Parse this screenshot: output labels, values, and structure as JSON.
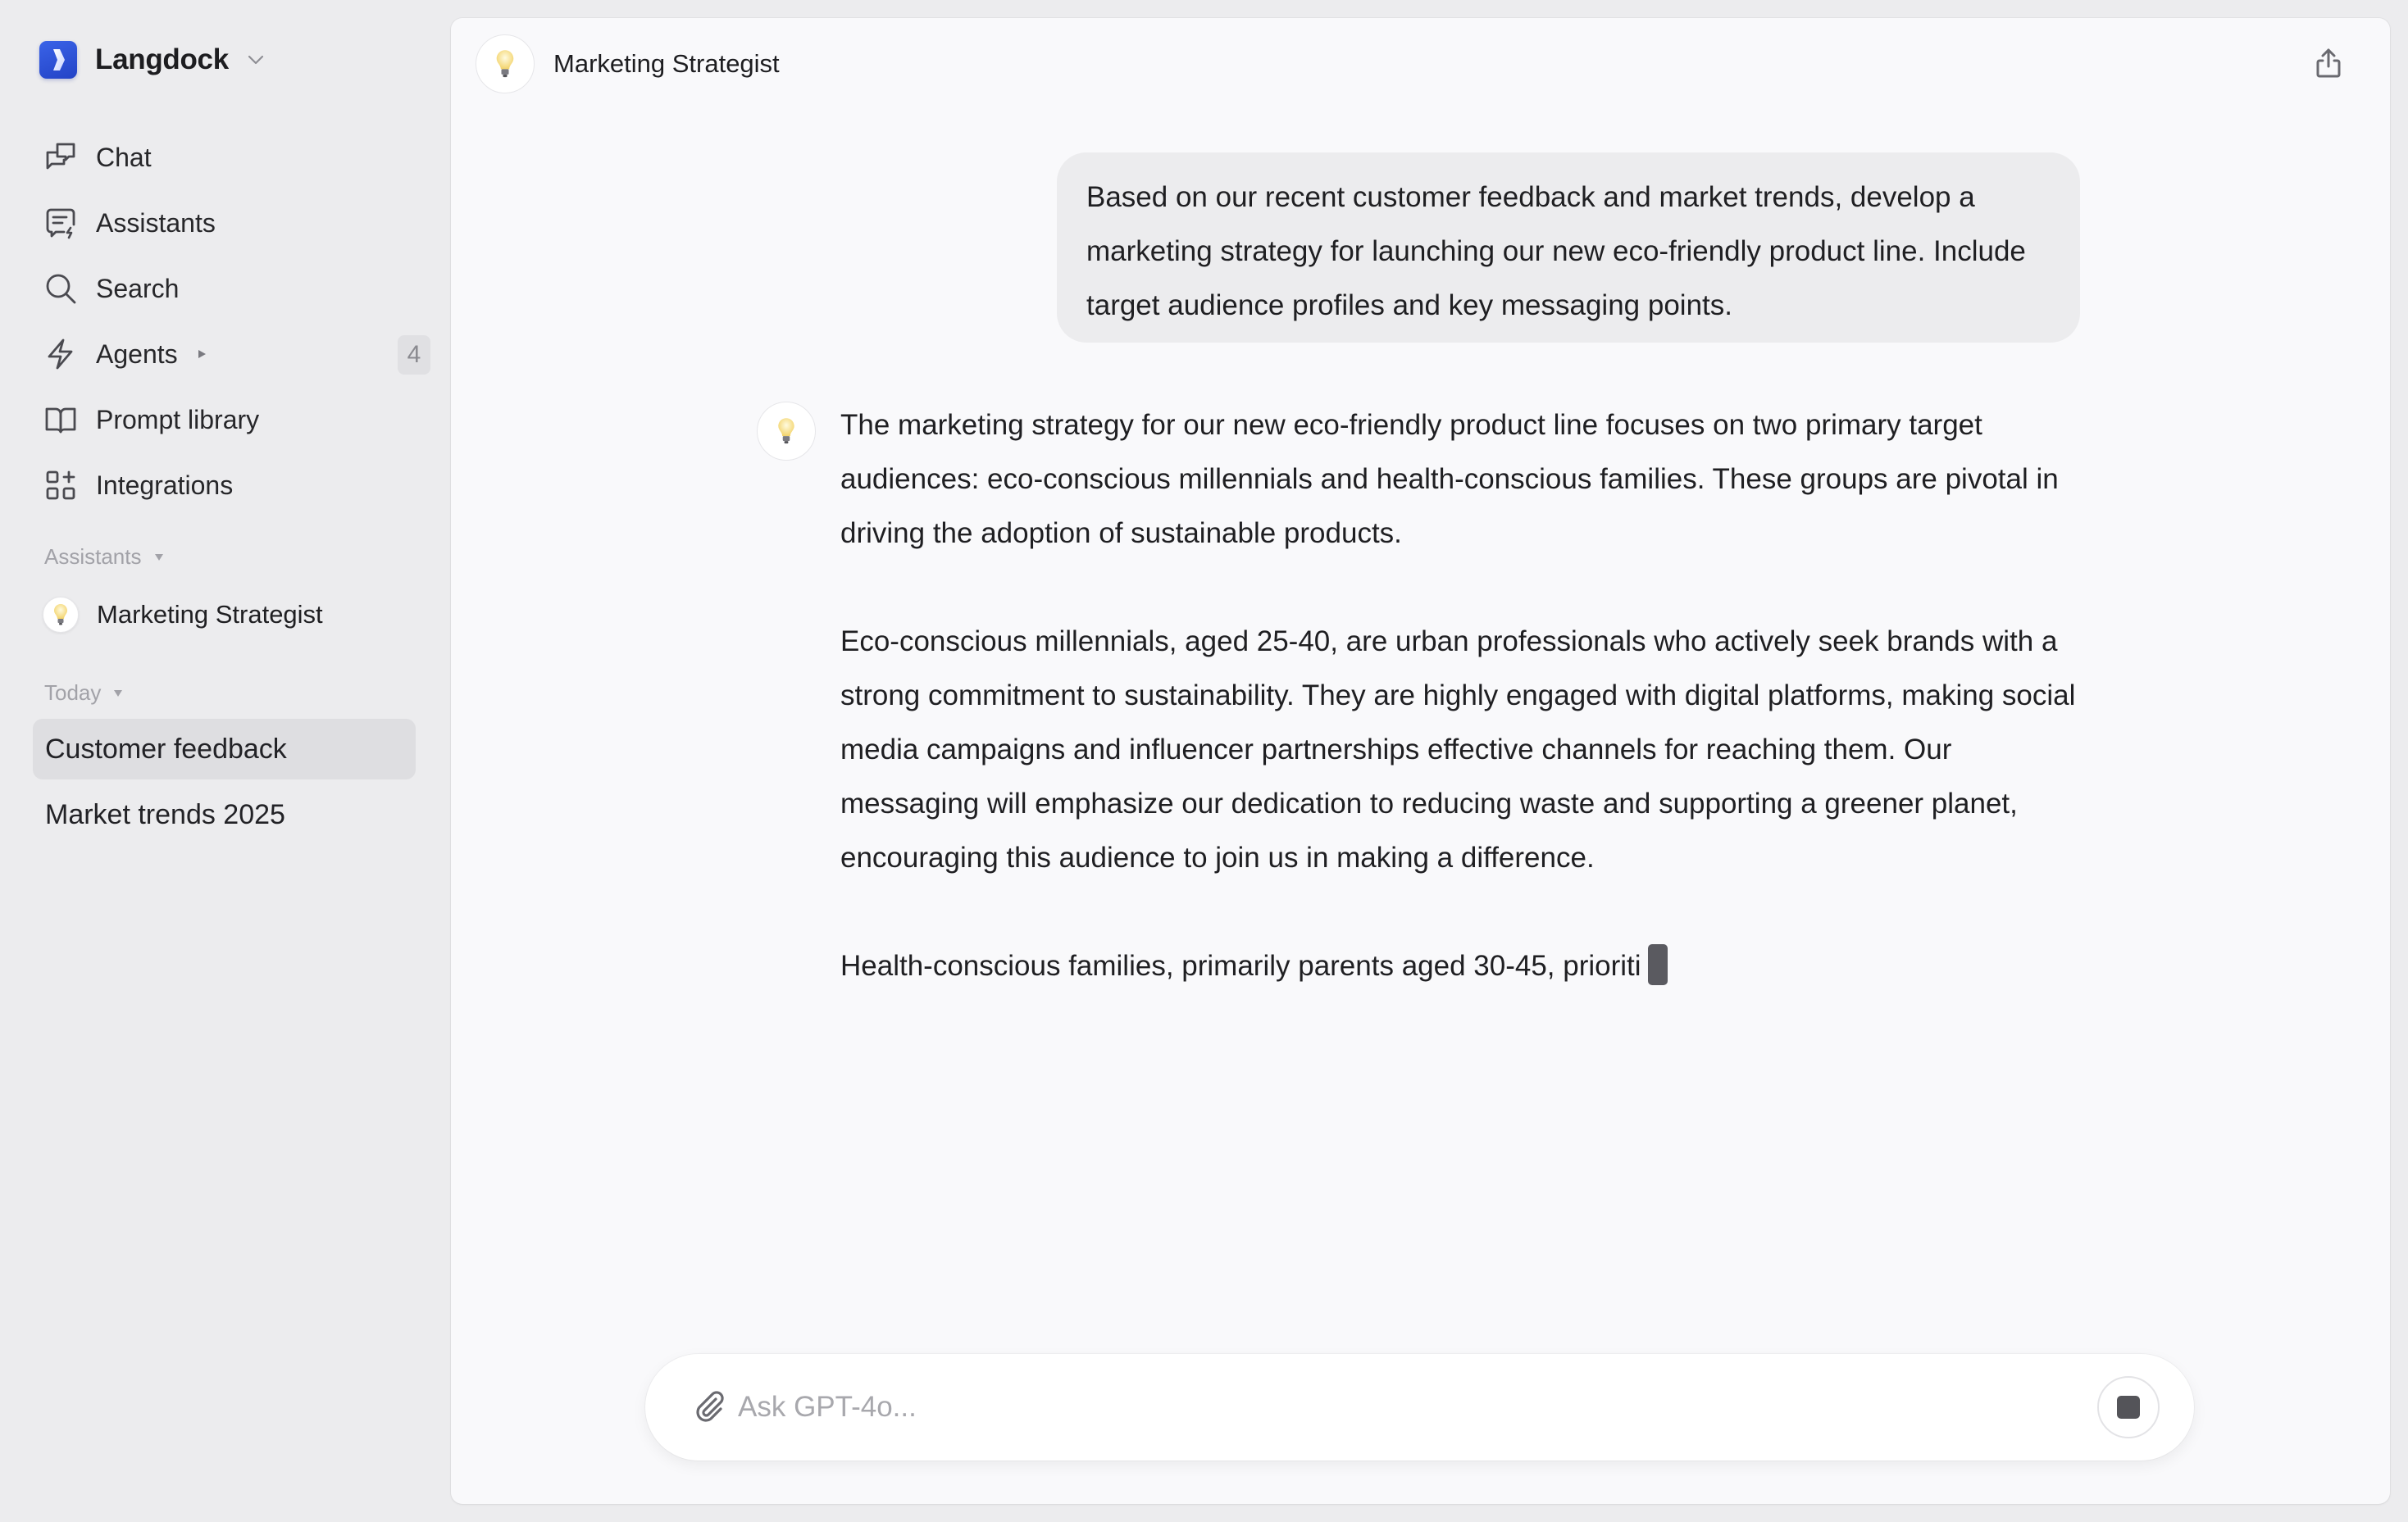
{
  "app": {
    "name": "Langdock",
    "brand_color": "#2d50d8"
  },
  "sidebar": {
    "nav": [
      {
        "label": "Chat",
        "icon": "chat-bubbles-icon"
      },
      {
        "label": "Assistants",
        "icon": "assistant-message-icon"
      },
      {
        "label": "Search",
        "icon": "search-icon"
      },
      {
        "label": "Agents",
        "icon": "lightning-icon",
        "badge": "4"
      },
      {
        "label": "Prompt library",
        "icon": "book-icon"
      },
      {
        "label": "Integrations",
        "icon": "grid-plus-icon"
      }
    ],
    "assistants_section": {
      "label": "Assistants",
      "items": [
        {
          "label": "Marketing Strategist",
          "icon": "lightbulb-icon"
        }
      ]
    },
    "history_section": {
      "label": "Today",
      "items": [
        {
          "label": "Customer feedback",
          "active": true
        },
        {
          "label": "Market trends 2025",
          "active": false
        }
      ]
    }
  },
  "header": {
    "assistant_name": "Marketing Strategist",
    "share_icon": "share-icon"
  },
  "conversation": {
    "user_message": "Based on our recent customer feedback and market trends, develop a marketing strategy for launching our new eco-friendly product line. Include target audience profiles and key messaging points.",
    "assistant_paragraphs": [
      "The marketing strategy for our new eco-friendly product line focuses on two primary target audiences: eco-conscious millennials and health-conscious families. These groups are pivotal in driving the adoption of sustainable products.",
      "Eco-conscious millennials, aged 25-40, are urban professionals who actively seek brands with a strong commitment to sustainability. They are highly engaged with digital platforms, making social media campaigns and influencer partnerships effective channels for reaching them. Our messaging will emphasize our dedication to reducing waste and supporting a greener planet, encouraging this audience to join us in making a difference.",
      "Health-conscious families, primarily parents aged 30-45, prioriti"
    ],
    "streaming": true
  },
  "composer": {
    "placeholder": "Ask GPT-4o...",
    "value": "",
    "attach_icon": "paperclip-icon",
    "stop_icon": "stop-icon"
  }
}
